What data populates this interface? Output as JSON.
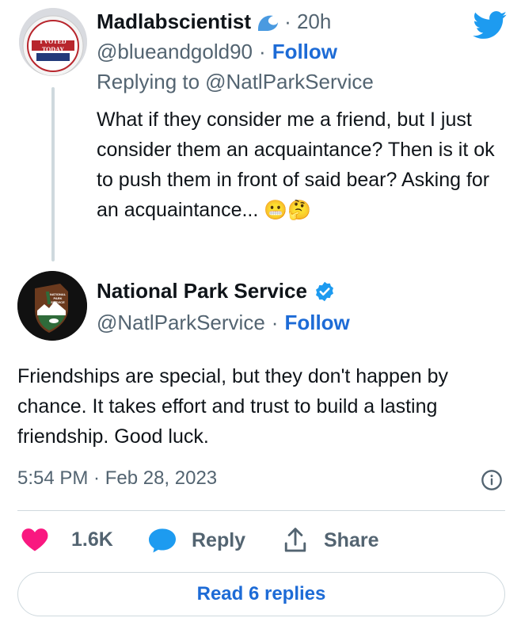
{
  "reply_tweet": {
    "display_name": "Madlabscientist",
    "time": "· 20h",
    "handle": "@blueandgold90",
    "separator": "·",
    "follow_label": "Follow",
    "replying_prefix": "Replying to",
    "replying_to": "@NatlParkService",
    "text": "What if they consider me a friend, but I just consider them an acquaintance? Then is it ok to push them in front of said bear?  Asking for an acquaintance...",
    "emoji": "😬🤔",
    "avatar_badge_text": "I VOTED TODAY"
  },
  "main_tweet": {
    "display_name": "National Park Service",
    "handle": "@NatlParkService",
    "separator": "·",
    "follow_label": "Follow",
    "text": "Friendships are special, but they don't happen by chance. It takes effort and trust to build a lasting friendship. Good luck.",
    "timestamp": "5:54 PM · Feb 28, 2023",
    "avatar_text": "NATIONAL PARK SERVICE"
  },
  "actions": {
    "like_count": "1.6K",
    "reply_label": "Reply",
    "share_label": "Share"
  },
  "read_replies_label": "Read 6 replies",
  "colors": {
    "twitter_blue": "#1d9bf0",
    "link_blue": "#1d6bd6",
    "like_pink": "#f91880",
    "muted": "#536471"
  }
}
